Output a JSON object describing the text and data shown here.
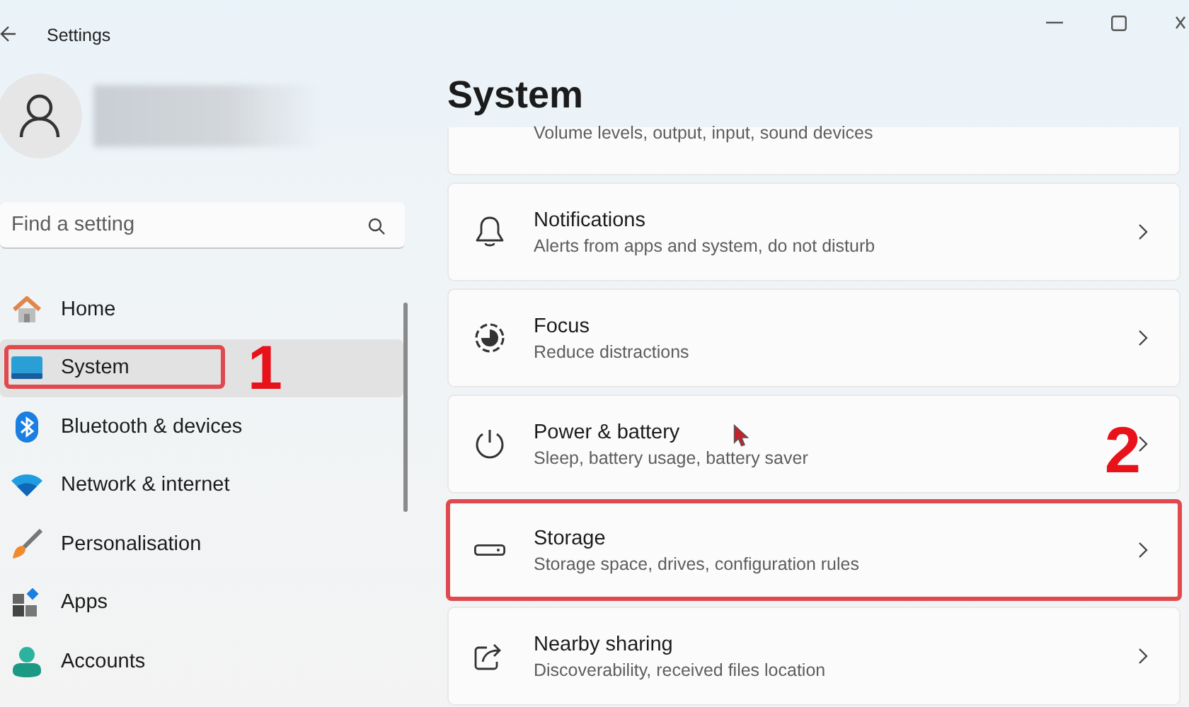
{
  "window": {
    "title": "Settings"
  },
  "search": {
    "placeholder": "Find a setting"
  },
  "nav": [
    {
      "label": "Home",
      "kind": "home",
      "selected": false,
      "marked": false
    },
    {
      "label": "System",
      "kind": "system",
      "selected": true,
      "marked": true,
      "annotation": "1"
    },
    {
      "label": "Bluetooth & devices",
      "kind": "bluetooth",
      "selected": false,
      "marked": false
    },
    {
      "label": "Network & internet",
      "kind": "network",
      "selected": false,
      "marked": false
    },
    {
      "label": "Personalisation",
      "kind": "brush",
      "selected": false,
      "marked": false
    },
    {
      "label": "Apps",
      "kind": "apps",
      "selected": false,
      "marked": false
    },
    {
      "label": "Accounts",
      "kind": "accounts",
      "selected": false,
      "marked": false
    }
  ],
  "page": {
    "title": "System"
  },
  "cards": [
    {
      "kind": "partial",
      "description": "Volume levels, output, input, sound devices"
    },
    {
      "kind": "bell",
      "title": "Notifications",
      "description": "Alerts from apps and system, do not disturb",
      "marked": false
    },
    {
      "kind": "focus",
      "title": "Focus",
      "description": "Reduce distractions",
      "marked": false
    },
    {
      "kind": "power",
      "title": "Power & battery",
      "description": "Sleep, battery usage, battery saver",
      "marked": false,
      "annotation": "2"
    },
    {
      "kind": "storage",
      "title": "Storage",
      "description": "Storage space, drives, configuration rules",
      "marked": true
    },
    {
      "kind": "share",
      "title": "Nearby sharing",
      "description": "Discoverability, received files location",
      "marked": false
    }
  ]
}
